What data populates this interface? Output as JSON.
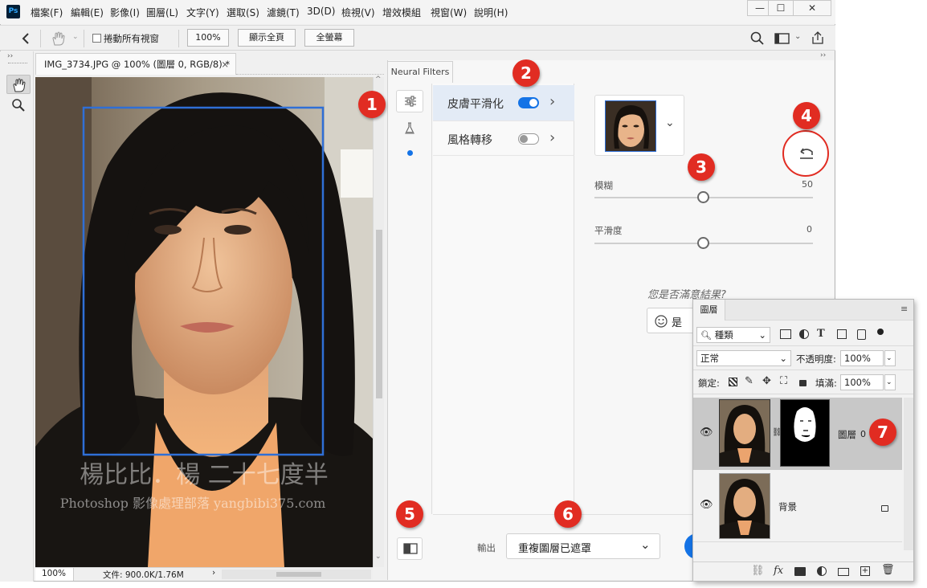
{
  "app": {
    "logo": "Ps",
    "menus": [
      "檔案(F)",
      "編輯(E)",
      "影像(I)",
      "圖層(L)",
      "文字(Y)",
      "選取(S)",
      "濾鏡(T)",
      "3D(D)",
      "檢視(V)",
      "增效模組",
      "視窗(W)",
      "說明(H)"
    ],
    "window_controls": {
      "minimize": "—",
      "maximize": "☐",
      "close": "✕"
    }
  },
  "options_bar": {
    "scroll_all_label": "捲動所有視窗",
    "zoom_100": "100%",
    "fit_screen": "顯示全頁",
    "fill_screen": "全螢幕"
  },
  "document": {
    "tab_title": "IMG_3734.JPG @ 100% (圖層 0, RGB/8) *",
    "close_glyph": "×",
    "watermark_line1": "楊比比．楊 二十七度半",
    "watermark_line2": "Photoshop 影像處理部落 yangbibi375.com",
    "zoom": "100%",
    "doc_info": "文件: 900.0K/1.76M"
  },
  "neural_filters": {
    "tab_label": "Neural Filters",
    "filters": [
      {
        "name": "皮膚平滑化",
        "enabled": true
      },
      {
        "name": "風格轉移",
        "enabled": false
      }
    ],
    "sliders": [
      {
        "label": "模糊",
        "value": "50",
        "level": 0.5
      },
      {
        "label": "平滑度",
        "value": "0",
        "level": 0.5
      }
    ],
    "feedback_question": "您是否滿意結果?",
    "feedback_yes": "是",
    "output_label": "輸出",
    "output_value": "重複圖層已遮罩"
  },
  "callouts": [
    "1",
    "2",
    "3",
    "4",
    "5",
    "6",
    "7"
  ],
  "layers_panel": {
    "tab": "圖層",
    "filter_kind": "種類",
    "blend_mode": "正常",
    "opacity_label": "不透明度:",
    "opacity_value": "100%",
    "lock_label": "鎖定:",
    "fill_label": "填滿:",
    "fill_value": "100%",
    "layers": [
      {
        "name": "圖層",
        "suffix": "0",
        "has_mask": true,
        "selected": true
      },
      {
        "name": "背景",
        "locked": true
      }
    ],
    "footer_icons": [
      "link-icon",
      "fx-icon",
      "mask-icon",
      "adjustment-icon",
      "folder-icon",
      "new-layer-icon",
      "trash-icon"
    ]
  },
  "colors": {
    "accent": "#1473e6",
    "callout": "#e12c22",
    "face_box": "#2f6fd6"
  }
}
